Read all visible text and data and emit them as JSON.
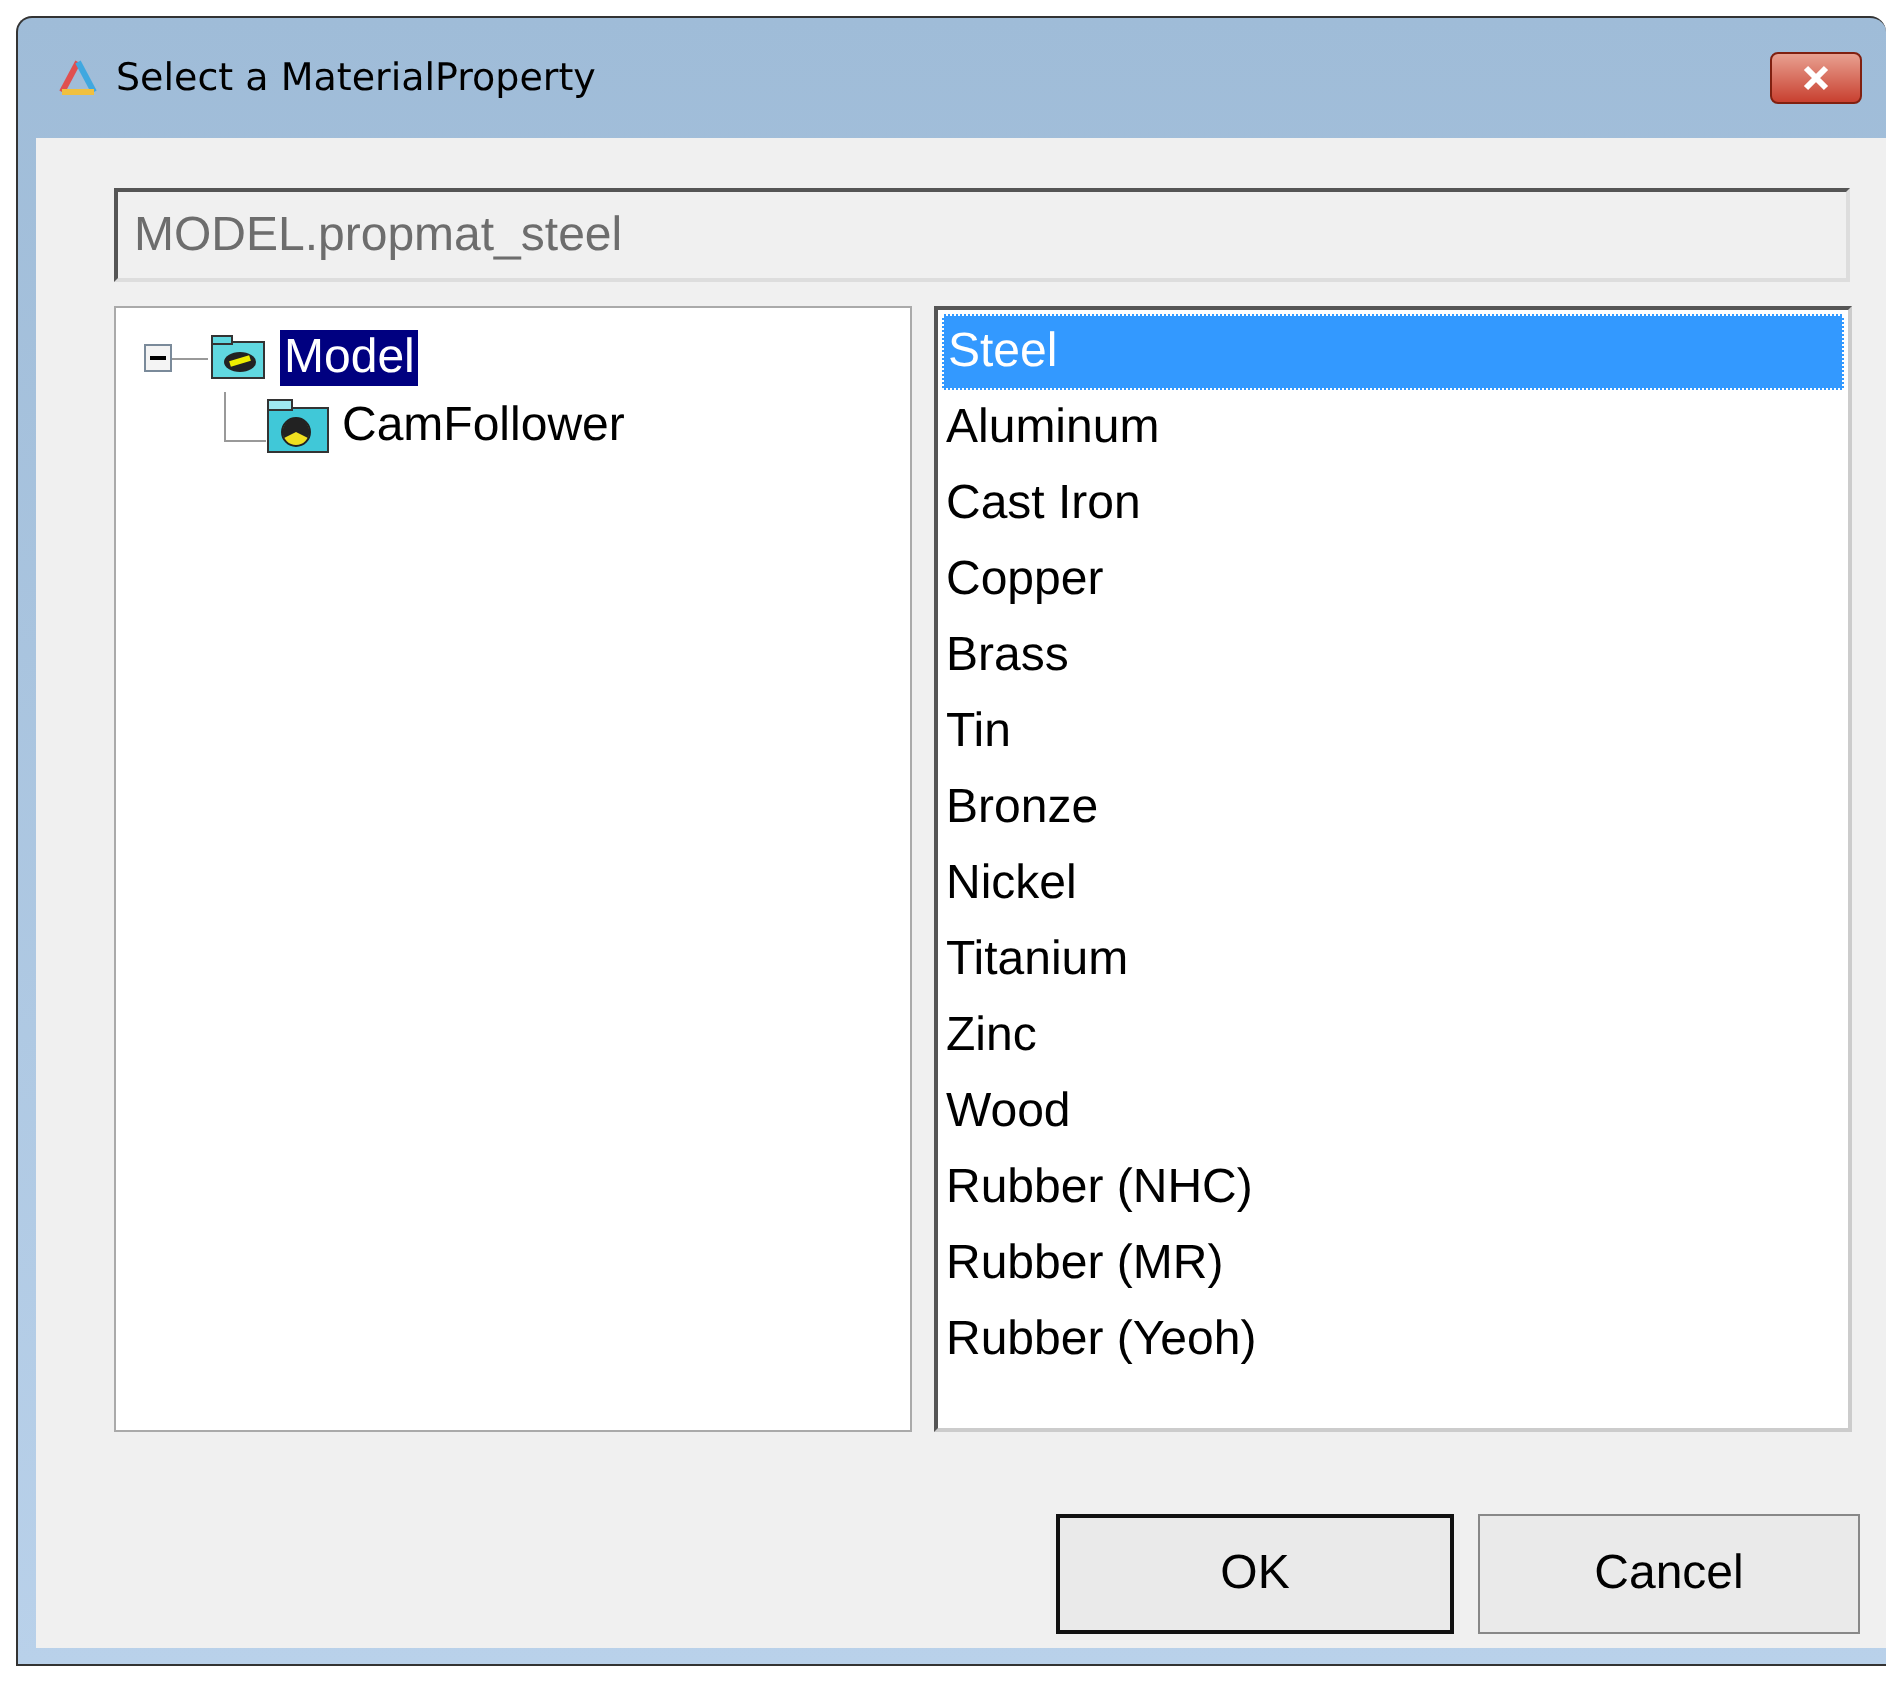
{
  "window": {
    "title": "Select a MaterialProperty"
  },
  "path_field": {
    "value": "MODEL.propmat_steel",
    "disabled": true
  },
  "tree": [
    {
      "label": "Model",
      "selected": true,
      "expanded": true,
      "kind": "root",
      "children": [
        {
          "label": "CamFollower",
          "selected": false,
          "kind": "item"
        }
      ]
    }
  ],
  "materials": [
    {
      "label": "Steel",
      "selected": true
    },
    {
      "label": "Aluminum",
      "selected": false
    },
    {
      "label": "Cast Iron",
      "selected": false
    },
    {
      "label": "Copper",
      "selected": false
    },
    {
      "label": "Brass",
      "selected": false
    },
    {
      "label": "Tin",
      "selected": false
    },
    {
      "label": "Bronze",
      "selected": false
    },
    {
      "label": "Nickel",
      "selected": false
    },
    {
      "label": "Titanium",
      "selected": false
    },
    {
      "label": "Zinc",
      "selected": false
    },
    {
      "label": "Wood",
      "selected": false
    },
    {
      "label": "Rubber (NHC)",
      "selected": false
    },
    {
      "label": "Rubber (MR)",
      "selected": false
    },
    {
      "label": "Rubber (Yeoh)",
      "selected": false
    }
  ],
  "buttons": [
    {
      "label": "OK",
      "default": true
    },
    {
      "label": "Cancel",
      "default": false
    }
  ]
}
